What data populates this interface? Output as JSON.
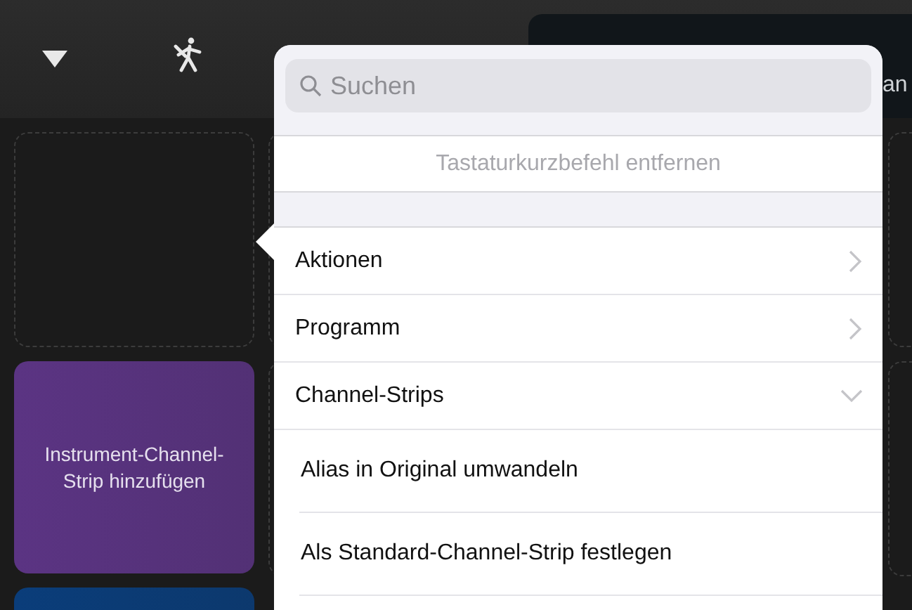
{
  "top_picks": {
    "label": "an"
  },
  "pads": [
    {
      "kind": "empty"
    },
    {
      "kind": "add",
      "label": "Instrument-Channel-Strip hinzufügen",
      "color": "#5b3483"
    },
    {
      "kind": "add",
      "color": "#0a3d7a"
    }
  ],
  "popover": {
    "search": {
      "placeholder": "Suchen"
    },
    "remove_shortcut": "Tastaturkurzbefehl entfernen",
    "menu": [
      {
        "label": "Aktionen",
        "expanded": false
      },
      {
        "label": "Programm",
        "expanded": false
      },
      {
        "label": "Channel-Strips",
        "expanded": true,
        "children": [
          {
            "label": "Alias in Original umwandeln"
          },
          {
            "label": "Als Standard-Channel-Strip festlegen"
          }
        ]
      }
    ]
  }
}
